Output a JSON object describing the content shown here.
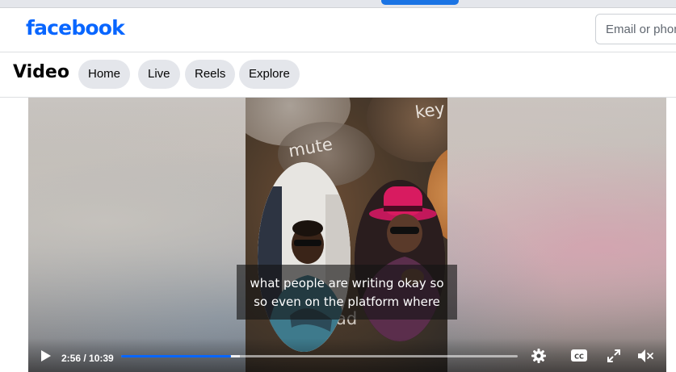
{
  "header": {
    "logo_text": "facebook",
    "email_placeholder": "Email or phone"
  },
  "subnav": {
    "title": "Video",
    "tabs": [
      {
        "label": "Home"
      },
      {
        "label": "Live"
      },
      {
        "label": "Reels"
      },
      {
        "label": "Explore"
      }
    ]
  },
  "video": {
    "overlay_words": [
      "mute",
      "key",
      "ad"
    ],
    "caption_lines": [
      "what people are writing okay so",
      "so even on the platform where"
    ],
    "time_display": "2:56 / 10:39",
    "progress_fraction": 0.276,
    "buffered_fraction": 0.3,
    "icons": [
      "play-icon",
      "settings-icon",
      "closed-captions-icon",
      "fullscreen-icon",
      "muted-volume-icon"
    ]
  },
  "colors": {
    "brand": "#0866ff",
    "tab_bg": "#e4e6eb",
    "progress": "#0866ff"
  }
}
